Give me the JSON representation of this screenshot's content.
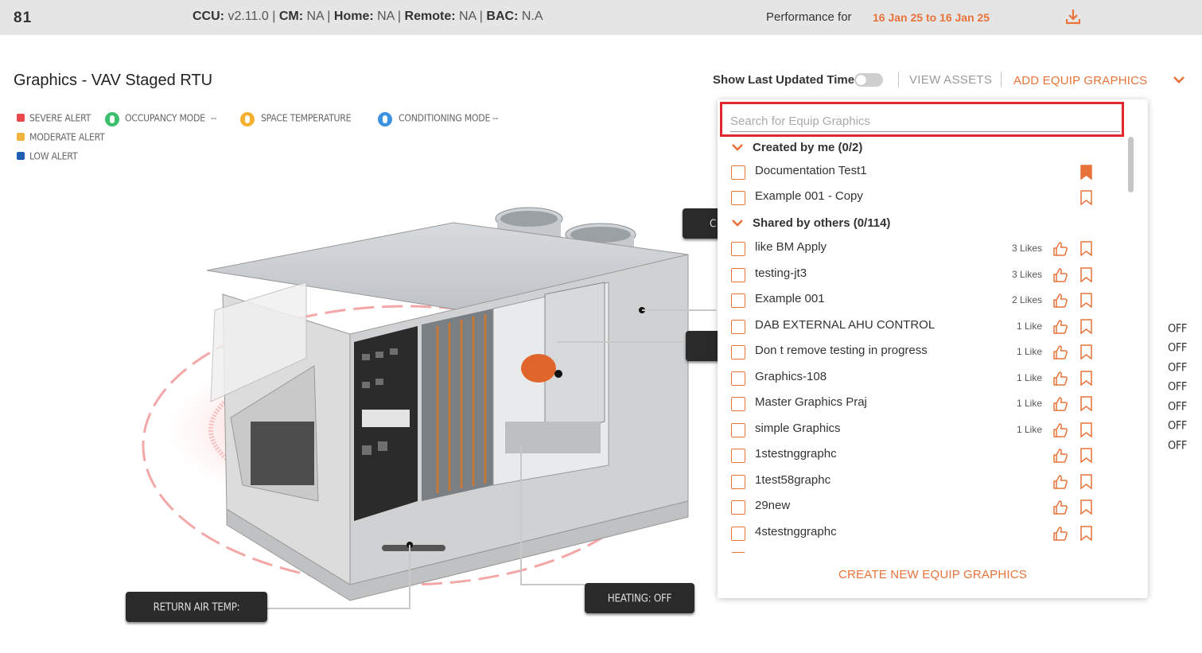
{
  "topbar": {
    "site_id": "81",
    "ccu_label": "CCU:",
    "ccu_value": "v2.11.0",
    "cm_label": "CM:",
    "cm_value": "NA",
    "home_label": "Home:",
    "home_value": "NA",
    "remote_label": "Remote:",
    "remote_value": "NA",
    "bac_label": "BAC:",
    "bac_value": "N.A",
    "performance_label": "Performance for",
    "performance_range": "16 Jan 25 to 16 Jan 25",
    "download_icon": "download-icon"
  },
  "header": {
    "title": "Graphics - VAV Staged RTU",
    "show_last_updated": "Show Last Updated Time",
    "toggle_on": false,
    "view_assets": "VIEW ASSETS",
    "add_equip_graphics": "ADD EQUIP GRAPHICS"
  },
  "legend": {
    "severe": "SEVERE ALERT",
    "moderate": "MODERATE ALERT",
    "low": "LOW ALERT",
    "occupancy": "OCCUPANCY MODE",
    "occupancy_value": "--",
    "space_temp": "SPACE TEMPERATURE",
    "conditioning": "CONDITIONING MODE",
    "conditioning_value": "--",
    "colors": {
      "severe": "#e8474b",
      "moderate": "#f2b13a",
      "low": "#1e5fb4",
      "occupancy": "#3cc06e",
      "space_temp": "#f6b030",
      "conditioning": "#3a92e0"
    }
  },
  "callouts": {
    "return_air_temp": "RETURN AIR TEMP:",
    "heating": "HEATING: OFF",
    "partial_top": "C"
  },
  "status_values": [
    "OFF",
    "OFF",
    "OFF",
    "OFF",
    "OFF",
    "OFF",
    "OFF"
  ],
  "dropdown": {
    "search_placeholder": "Search for Equip Graphics",
    "created_by_me": "Created by me (0/2)",
    "created_items": [
      {
        "name": "Documentation Test1",
        "bookmarked": true
      },
      {
        "name": "Example 001 - Copy",
        "bookmarked": false
      }
    ],
    "shared_by_others": "Shared by others (0/114)",
    "shared_items": [
      {
        "name": "like BM Apply",
        "likes": "3 Likes"
      },
      {
        "name": "testing-jt3",
        "likes": "3 Likes"
      },
      {
        "name": "Example 001",
        "likes": "2 Likes"
      },
      {
        "name": "DAB EXTERNAL AHU CONTROL",
        "likes": "1 Like"
      },
      {
        "name": "Don t remove testing in progress",
        "likes": "1 Like"
      },
      {
        "name": "Graphics-108",
        "likes": "1 Like"
      },
      {
        "name": "Master Graphics Praj",
        "likes": "1 Like"
      },
      {
        "name": "simple Graphics",
        "likes": "1 Like"
      },
      {
        "name": "1stestnggraphc",
        "likes": ""
      },
      {
        "name": "1test58graphc",
        "likes": ""
      },
      {
        "name": "29new",
        "likes": ""
      },
      {
        "name": "4stestnggraphc",
        "likes": ""
      }
    ],
    "create_new": "CREATE NEW EQUIP GRAPHICS",
    "accent_color": "#e8733a",
    "highlight_color": "#e3262b"
  }
}
